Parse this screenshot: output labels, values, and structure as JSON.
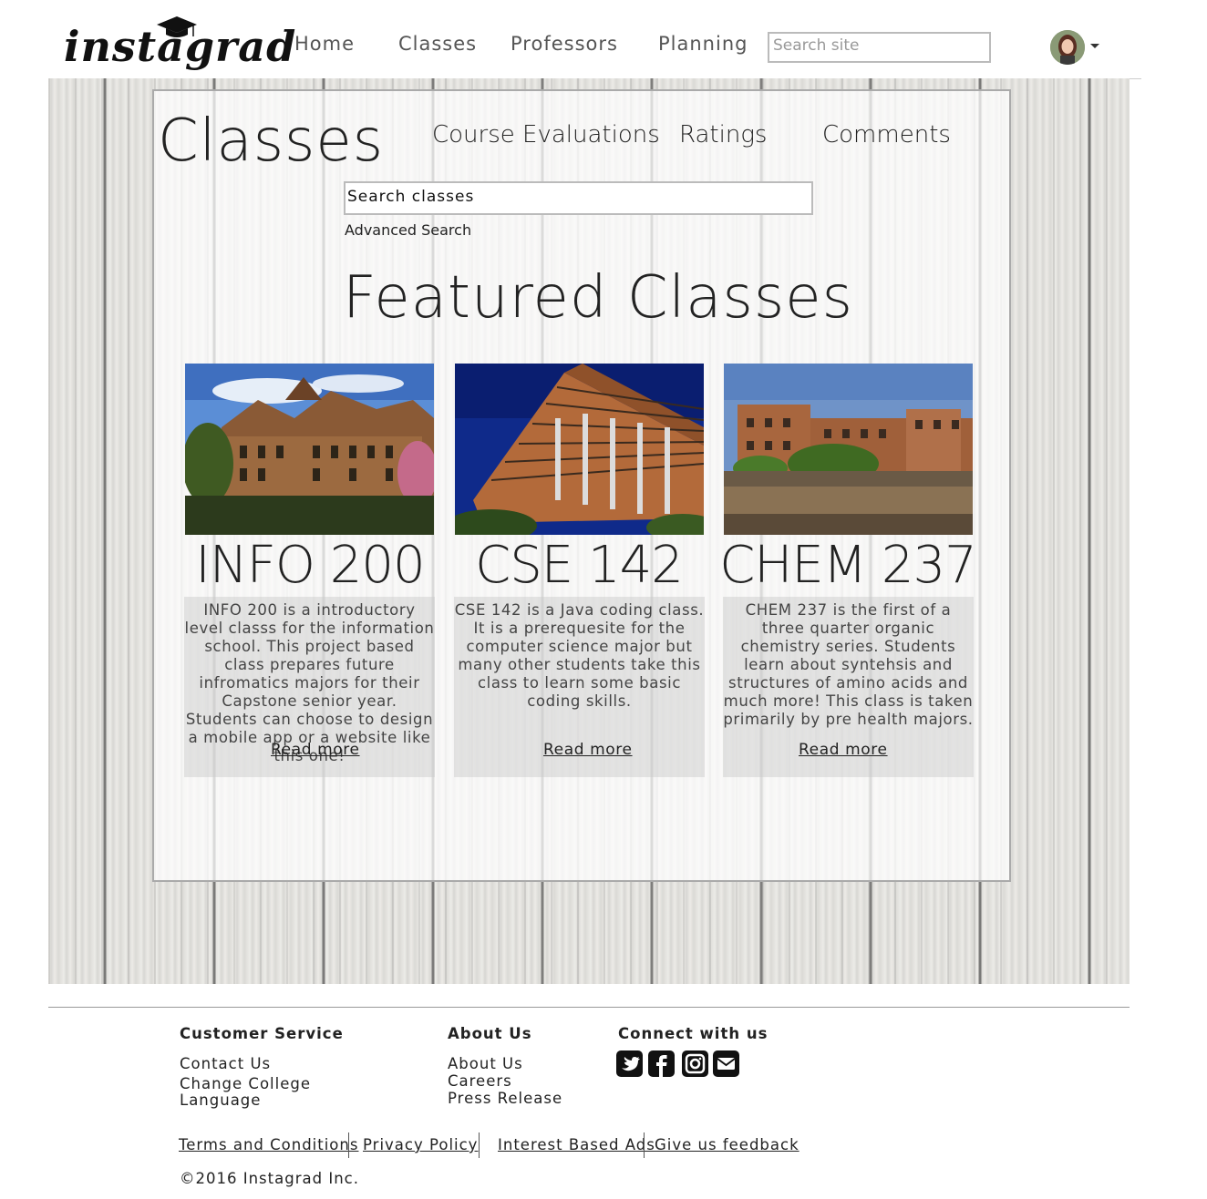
{
  "nav": {
    "logo_text": "instagrad",
    "links": [
      "Home",
      "Classes",
      "Professors",
      "Planning"
    ],
    "search_placeholder": "Search site"
  },
  "page": {
    "title": "Classes",
    "sub_links": [
      "Course Evaluations",
      "Ratings",
      "Comments"
    ],
    "search_value": "Search classes",
    "advanced_search": "Advanced Search",
    "featured_title": "Featured Classes"
  },
  "cards": [
    {
      "title": "INFO 200",
      "description": "INFO 200 is a introductory level classs for the information school.  This project based class prepares future infromatics majors for their Capstone senior year. Students can choose to design a mobile app or a website like this one!",
      "read_more": "Read more"
    },
    {
      "title": "CSE 142",
      "description": "CSE 142 is a Java coding class. It is a prerequesite for the computer science major but many other students take this class to learn some basic coding skills.",
      "read_more": "Read more"
    },
    {
      "title": "CHEM 237",
      "description": "CHEM 237 is the first of a three quarter organic chemistry series. Students learn about syntehsis and structures of amino acids and much more! This class is taken primarily by pre health majors.",
      "read_more": "Read more"
    }
  ],
  "footer": {
    "customer_service": {
      "heading": "Customer Service",
      "links": [
        "Contact Us",
        "Change College",
        "Language"
      ]
    },
    "about": {
      "heading": "About Us",
      "links": [
        "About Us",
        "Careers",
        "Press Release"
      ]
    },
    "connect": {
      "heading": "Connect with us",
      "icons": [
        "twitter-icon",
        "facebook-icon",
        "instagram-icon",
        "email-icon"
      ]
    },
    "legal_links": [
      "Terms and Conditions",
      "Privacy Policy",
      "Interest Based Ads",
      "Give us feedback"
    ],
    "copyright": "©2016 Instagrad Inc."
  }
}
